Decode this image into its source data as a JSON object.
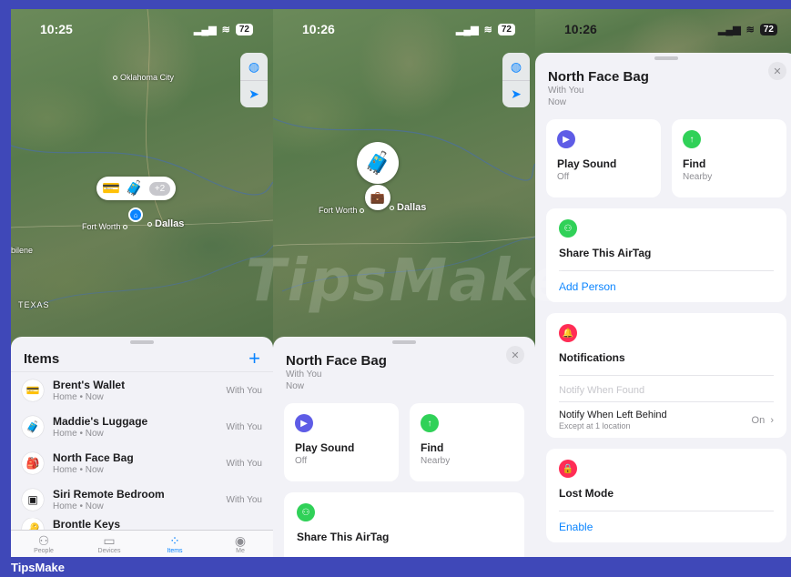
{
  "status": {
    "time1": "10:25",
    "time2": "10:26",
    "time3": "10:26",
    "battery": "72"
  },
  "map": {
    "cities": [
      "Oklahoma City",
      "Fort Worth",
      "Dallas",
      "bilene",
      "TEXAS"
    ],
    "pill_more": "+2"
  },
  "items_panel": {
    "title": "Items",
    "add_label": "+",
    "items": [
      {
        "name": "Brent's Wallet",
        "status": "Home • Now",
        "location": "With You",
        "icon": "wallet-icon"
      },
      {
        "name": "Maddie's Luggage",
        "status": "Home • Now",
        "location": "With You",
        "icon": "luggage-icon"
      },
      {
        "name": "North Face Bag",
        "status": "Home • Now",
        "location": "With You",
        "icon": "bag-icon"
      },
      {
        "name": "Siri Remote Bedroom",
        "status": "Home • Now",
        "location": "With You",
        "icon": "remote-icon"
      },
      {
        "name": "Brontle Keys",
        "status": "",
        "location": "",
        "icon": "keys-icon"
      }
    ],
    "tabs": [
      "People",
      "Devices",
      "Items",
      "Me"
    ]
  },
  "detail": {
    "title": "North Face Bag",
    "with": "With You",
    "time": "Now",
    "close": "✕",
    "play_sound": {
      "label": "Play Sound",
      "sub": "Off"
    },
    "find": {
      "label": "Find",
      "sub": "Nearby"
    },
    "share": {
      "label": "Share This AirTag",
      "add": "Add Person"
    },
    "notifications": {
      "label": "Notifications",
      "notify_found": "Notify When Found",
      "left_behind": "Notify When Left Behind",
      "left_behind_sub": "Except at 1 location",
      "left_behind_value": "On"
    },
    "lost_mode": {
      "label": "Lost Mode",
      "enable": "Enable"
    }
  },
  "watermark": "TipsMake",
  "footer": "TipsMake",
  "colors": {
    "accent": "#0a84ff",
    "purple": "#5e5ce6",
    "green": "#30d158",
    "red": "#ff2d55",
    "brand_bar": "#3f48b8"
  }
}
